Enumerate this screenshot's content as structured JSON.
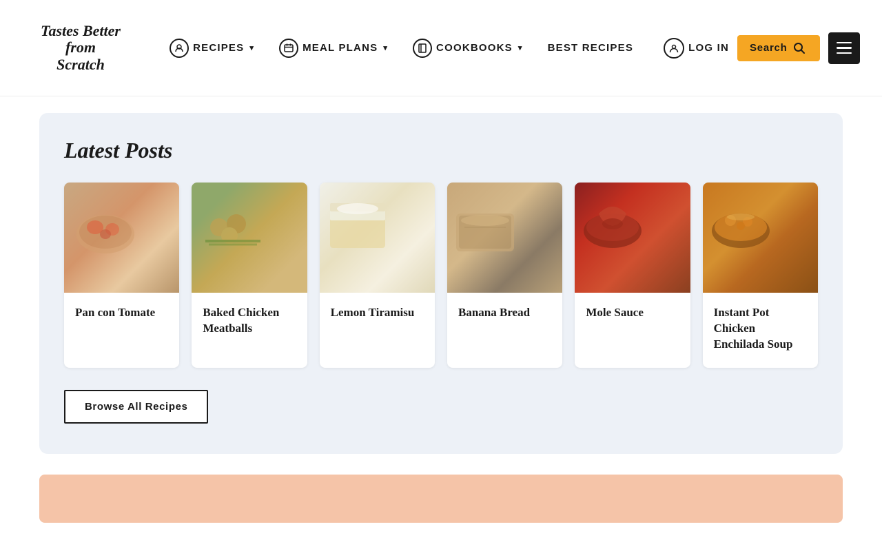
{
  "header": {
    "logo": {
      "line1": "Tastes Better",
      "line2": "from",
      "line3": "Scratch"
    },
    "nav": [
      {
        "id": "recipes",
        "label": "RECIPES",
        "hasIcon": true,
        "hasChevron": true,
        "iconSymbol": "🍽"
      },
      {
        "id": "meal-plans",
        "label": "MEAL PLANS",
        "hasIcon": true,
        "hasChevron": true,
        "iconSymbol": "📅"
      },
      {
        "id": "cookbooks",
        "label": "COOKBOOKS",
        "hasIcon": true,
        "hasChevron": true,
        "iconSymbol": "📖"
      },
      {
        "id": "best-recipes",
        "label": "BEST RECIPES",
        "hasIcon": false,
        "hasChevron": false
      }
    ],
    "logIn": {
      "label": "LOG IN",
      "iconSymbol": "👤"
    },
    "search": {
      "label": "Search",
      "iconSymbol": "🔍"
    },
    "menuIconSymbol": "≡"
  },
  "latestPosts": {
    "sectionTitle": "Latest Posts",
    "cards": [
      {
        "id": "pan-con-tomate",
        "title": "Pan con Tomate",
        "imageClass": "img-pan-con-tomate",
        "imageAlt": "Pan con Tomate dish"
      },
      {
        "id": "baked-chicken-meatballs",
        "title": "Baked Chicken Meatballs",
        "imageClass": "img-baked-chicken",
        "imageAlt": "Baked Chicken Meatballs dish"
      },
      {
        "id": "lemon-tiramisu",
        "title": "Lemon Tiramisu",
        "imageClass": "img-lemon-tiramisu",
        "imageAlt": "Lemon Tiramisu dessert"
      },
      {
        "id": "banana-bread",
        "title": "Banana Bread",
        "imageClass": "img-banana-bread",
        "imageAlt": "Banana Bread loaf"
      },
      {
        "id": "mole-sauce",
        "title": "Mole Sauce",
        "imageClass": "img-mole-sauce",
        "imageAlt": "Mole Sauce dish"
      },
      {
        "id": "instant-pot-chicken-enchilada-soup",
        "title": "Instant Pot Chicken Enchilada Soup",
        "imageClass": "img-enchilada-soup",
        "imageAlt": "Instant Pot Chicken Enchilada Soup"
      }
    ],
    "browseButton": "Browse All Recipes"
  }
}
